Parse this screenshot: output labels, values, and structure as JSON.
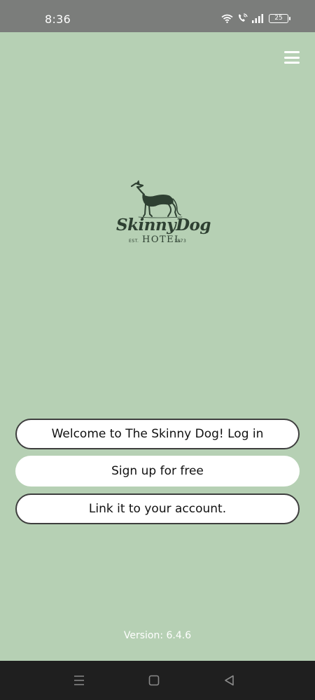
{
  "status_bar": {
    "time": "8:36",
    "battery": "25",
    "icons": [
      "wifi-icon",
      "wifi-call-icon",
      "signal-icon",
      "battery-icon"
    ]
  },
  "header": {
    "menu_icon": "hamburger-menu-icon"
  },
  "logo": {
    "script": "SkinnyDog",
    "est": "EST.",
    "hotel": "HOTEL",
    "year": "1873"
  },
  "actions": {
    "login_label": "Welcome to The Skinny Dog! Log in",
    "signup_label": "Sign up for free",
    "link_label": "Link it to your account."
  },
  "footer": {
    "version": "Version: 6.4.6"
  },
  "nav_bar": {
    "icons": [
      "recents-icon",
      "home-icon",
      "back-icon"
    ]
  },
  "colors": {
    "background": "#b6d0b4",
    "status_bar": "#7b7d7b",
    "button_bg": "#ffffff",
    "button_border": "#3e3e3e",
    "logo_ink": "#2e4032",
    "nav_bar": "#1f1f1f"
  }
}
